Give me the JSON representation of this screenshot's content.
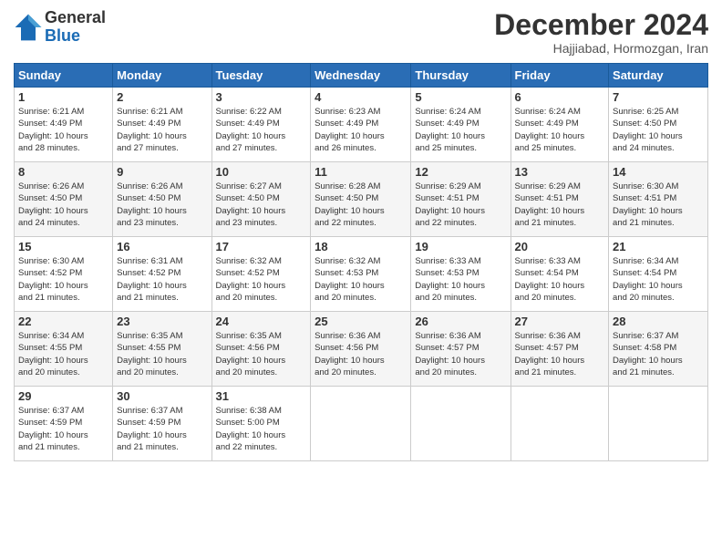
{
  "logo": {
    "general": "General",
    "blue": "Blue"
  },
  "title": "December 2024",
  "subtitle": "Hajjiabad, Hormozgan, Iran",
  "days_header": [
    "Sunday",
    "Monday",
    "Tuesday",
    "Wednesday",
    "Thursday",
    "Friday",
    "Saturday"
  ],
  "weeks": [
    [
      {
        "day": "1",
        "info": "Sunrise: 6:21 AM\nSunset: 4:49 PM\nDaylight: 10 hours\nand 28 minutes."
      },
      {
        "day": "2",
        "info": "Sunrise: 6:21 AM\nSunset: 4:49 PM\nDaylight: 10 hours\nand 27 minutes."
      },
      {
        "day": "3",
        "info": "Sunrise: 6:22 AM\nSunset: 4:49 PM\nDaylight: 10 hours\nand 27 minutes."
      },
      {
        "day": "4",
        "info": "Sunrise: 6:23 AM\nSunset: 4:49 PM\nDaylight: 10 hours\nand 26 minutes."
      },
      {
        "day": "5",
        "info": "Sunrise: 6:24 AM\nSunset: 4:49 PM\nDaylight: 10 hours\nand 25 minutes."
      },
      {
        "day": "6",
        "info": "Sunrise: 6:24 AM\nSunset: 4:49 PM\nDaylight: 10 hours\nand 25 minutes."
      },
      {
        "day": "7",
        "info": "Sunrise: 6:25 AM\nSunset: 4:50 PM\nDaylight: 10 hours\nand 24 minutes."
      }
    ],
    [
      {
        "day": "8",
        "info": "Sunrise: 6:26 AM\nSunset: 4:50 PM\nDaylight: 10 hours\nand 24 minutes."
      },
      {
        "day": "9",
        "info": "Sunrise: 6:26 AM\nSunset: 4:50 PM\nDaylight: 10 hours\nand 23 minutes."
      },
      {
        "day": "10",
        "info": "Sunrise: 6:27 AM\nSunset: 4:50 PM\nDaylight: 10 hours\nand 23 minutes."
      },
      {
        "day": "11",
        "info": "Sunrise: 6:28 AM\nSunset: 4:50 PM\nDaylight: 10 hours\nand 22 minutes."
      },
      {
        "day": "12",
        "info": "Sunrise: 6:29 AM\nSunset: 4:51 PM\nDaylight: 10 hours\nand 22 minutes."
      },
      {
        "day": "13",
        "info": "Sunrise: 6:29 AM\nSunset: 4:51 PM\nDaylight: 10 hours\nand 21 minutes."
      },
      {
        "day": "14",
        "info": "Sunrise: 6:30 AM\nSunset: 4:51 PM\nDaylight: 10 hours\nand 21 minutes."
      }
    ],
    [
      {
        "day": "15",
        "info": "Sunrise: 6:30 AM\nSunset: 4:52 PM\nDaylight: 10 hours\nand 21 minutes."
      },
      {
        "day": "16",
        "info": "Sunrise: 6:31 AM\nSunset: 4:52 PM\nDaylight: 10 hours\nand 21 minutes."
      },
      {
        "day": "17",
        "info": "Sunrise: 6:32 AM\nSunset: 4:52 PM\nDaylight: 10 hours\nand 20 minutes."
      },
      {
        "day": "18",
        "info": "Sunrise: 6:32 AM\nSunset: 4:53 PM\nDaylight: 10 hours\nand 20 minutes."
      },
      {
        "day": "19",
        "info": "Sunrise: 6:33 AM\nSunset: 4:53 PM\nDaylight: 10 hours\nand 20 minutes."
      },
      {
        "day": "20",
        "info": "Sunrise: 6:33 AM\nSunset: 4:54 PM\nDaylight: 10 hours\nand 20 minutes."
      },
      {
        "day": "21",
        "info": "Sunrise: 6:34 AM\nSunset: 4:54 PM\nDaylight: 10 hours\nand 20 minutes."
      }
    ],
    [
      {
        "day": "22",
        "info": "Sunrise: 6:34 AM\nSunset: 4:55 PM\nDaylight: 10 hours\nand 20 minutes."
      },
      {
        "day": "23",
        "info": "Sunrise: 6:35 AM\nSunset: 4:55 PM\nDaylight: 10 hours\nand 20 minutes."
      },
      {
        "day": "24",
        "info": "Sunrise: 6:35 AM\nSunset: 4:56 PM\nDaylight: 10 hours\nand 20 minutes."
      },
      {
        "day": "25",
        "info": "Sunrise: 6:36 AM\nSunset: 4:56 PM\nDaylight: 10 hours\nand 20 minutes."
      },
      {
        "day": "26",
        "info": "Sunrise: 6:36 AM\nSunset: 4:57 PM\nDaylight: 10 hours\nand 20 minutes."
      },
      {
        "day": "27",
        "info": "Sunrise: 6:36 AM\nSunset: 4:57 PM\nDaylight: 10 hours\nand 21 minutes."
      },
      {
        "day": "28",
        "info": "Sunrise: 6:37 AM\nSunset: 4:58 PM\nDaylight: 10 hours\nand 21 minutes."
      }
    ],
    [
      {
        "day": "29",
        "info": "Sunrise: 6:37 AM\nSunset: 4:59 PM\nDaylight: 10 hours\nand 21 minutes."
      },
      {
        "day": "30",
        "info": "Sunrise: 6:37 AM\nSunset: 4:59 PM\nDaylight: 10 hours\nand 21 minutes."
      },
      {
        "day": "31",
        "info": "Sunrise: 6:38 AM\nSunset: 5:00 PM\nDaylight: 10 hours\nand 22 minutes."
      },
      null,
      null,
      null,
      null
    ]
  ]
}
